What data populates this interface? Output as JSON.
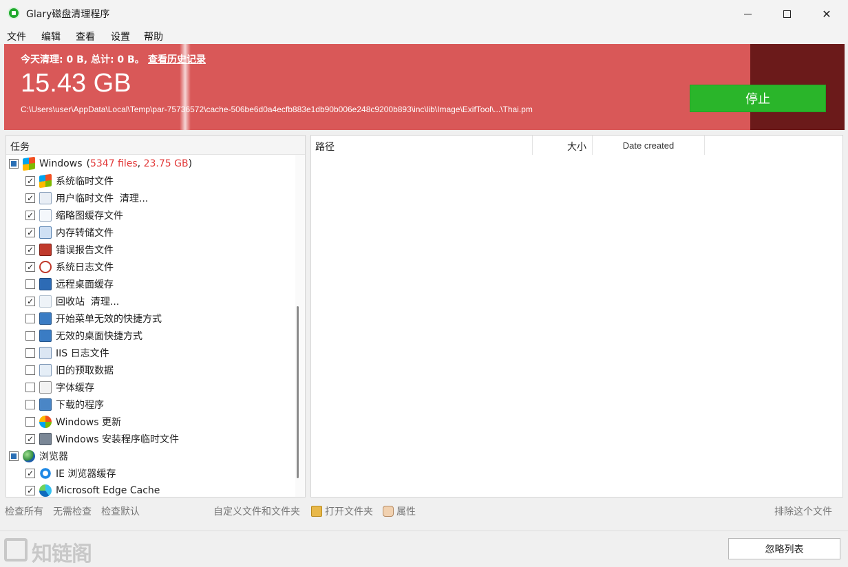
{
  "window": {
    "title": "Glary磁盘清理程序"
  },
  "menu": [
    "文件",
    "编辑",
    "查看",
    "设置",
    "帮助"
  ],
  "banner": {
    "today": "今天清理: 0 B, 总计: 0 B。",
    "history_link": "查看历史记录",
    "size": "15.43 GB",
    "current_path": "C:\\Users\\user\\AppData\\Local\\Temp\\par-75736572\\cache-506be6d0a4ecfb883e1db90b006e248c9200b893\\inc\\lib\\Image\\ExifTool\\...\\Thai.pm",
    "stop_label": "停止",
    "colors": {
      "banner": "#d95858",
      "stop": "#2ab52a"
    }
  },
  "tasks": {
    "header": "任务",
    "windows_group": {
      "label": "Windows",
      "stat_prefix": "(",
      "files": "5347 files",
      "sep": ", ",
      "size": "23.75 GB",
      "stat_suffix": ")",
      "state": "partial"
    },
    "windows_items": [
      {
        "label": "系统临时文件",
        "checked": true,
        "icon": "windows-flag-icon"
      },
      {
        "label": "用户临时文件  清理...",
        "checked": true,
        "icon": "user-doc-icon"
      },
      {
        "label": "缩略图缓存文件",
        "checked": true,
        "icon": "thumbnail-icon"
      },
      {
        "label": "内存转储文件",
        "checked": true,
        "icon": "memory-dump-icon"
      },
      {
        "label": "错误报告文件",
        "checked": true,
        "icon": "error-report-icon"
      },
      {
        "label": "系统日志文件",
        "checked": true,
        "icon": "system-log-icon"
      },
      {
        "label": "远程桌面缓存",
        "checked": false,
        "icon": "remote-desktop-icon"
      },
      {
        "label": "回收站  清理...",
        "checked": true,
        "icon": "recycle-bin-icon"
      },
      {
        "label": "开始菜单无效的快捷方式",
        "checked": false,
        "icon": "start-menu-shortcut-icon"
      },
      {
        "label": "无效的桌面快捷方式",
        "checked": false,
        "icon": "desktop-shortcut-icon"
      },
      {
        "label": "IIS 日志文件",
        "checked": false,
        "icon": "iis-log-icon"
      },
      {
        "label": "旧的预取数据",
        "checked": false,
        "icon": "prefetch-icon"
      },
      {
        "label": "字体缓存",
        "checked": false,
        "icon": "font-cache-icon"
      },
      {
        "label": "下载的程序",
        "checked": false,
        "icon": "downloaded-program-icon"
      },
      {
        "label": "Windows 更新",
        "checked": false,
        "icon": "windows-update-icon"
      },
      {
        "label": "Windows 安装程序临时文件",
        "checked": true,
        "icon": "installer-temp-icon"
      }
    ],
    "browser_group": {
      "label": "浏览器",
      "state": "partial"
    },
    "browser_items": [
      {
        "label": "IE 浏览器缓存",
        "checked": true,
        "icon": "ie-icon"
      },
      {
        "label": "Microsoft Edge Cache",
        "checked": true,
        "icon": "edge-icon"
      }
    ]
  },
  "results": {
    "col_path": "路径",
    "col_size": "大小",
    "col_date": "Date created"
  },
  "toolbar": {
    "check_all": "检查所有",
    "check_none": "无需检查",
    "check_default": "检查默认",
    "custom": "自定义文件和文件夹",
    "open_folder": "打开文件夹",
    "properties": "属性",
    "exclude": "排除这个文件"
  },
  "footer": {
    "ignore_list": "忽略列表",
    "watermark": "知链阁"
  }
}
